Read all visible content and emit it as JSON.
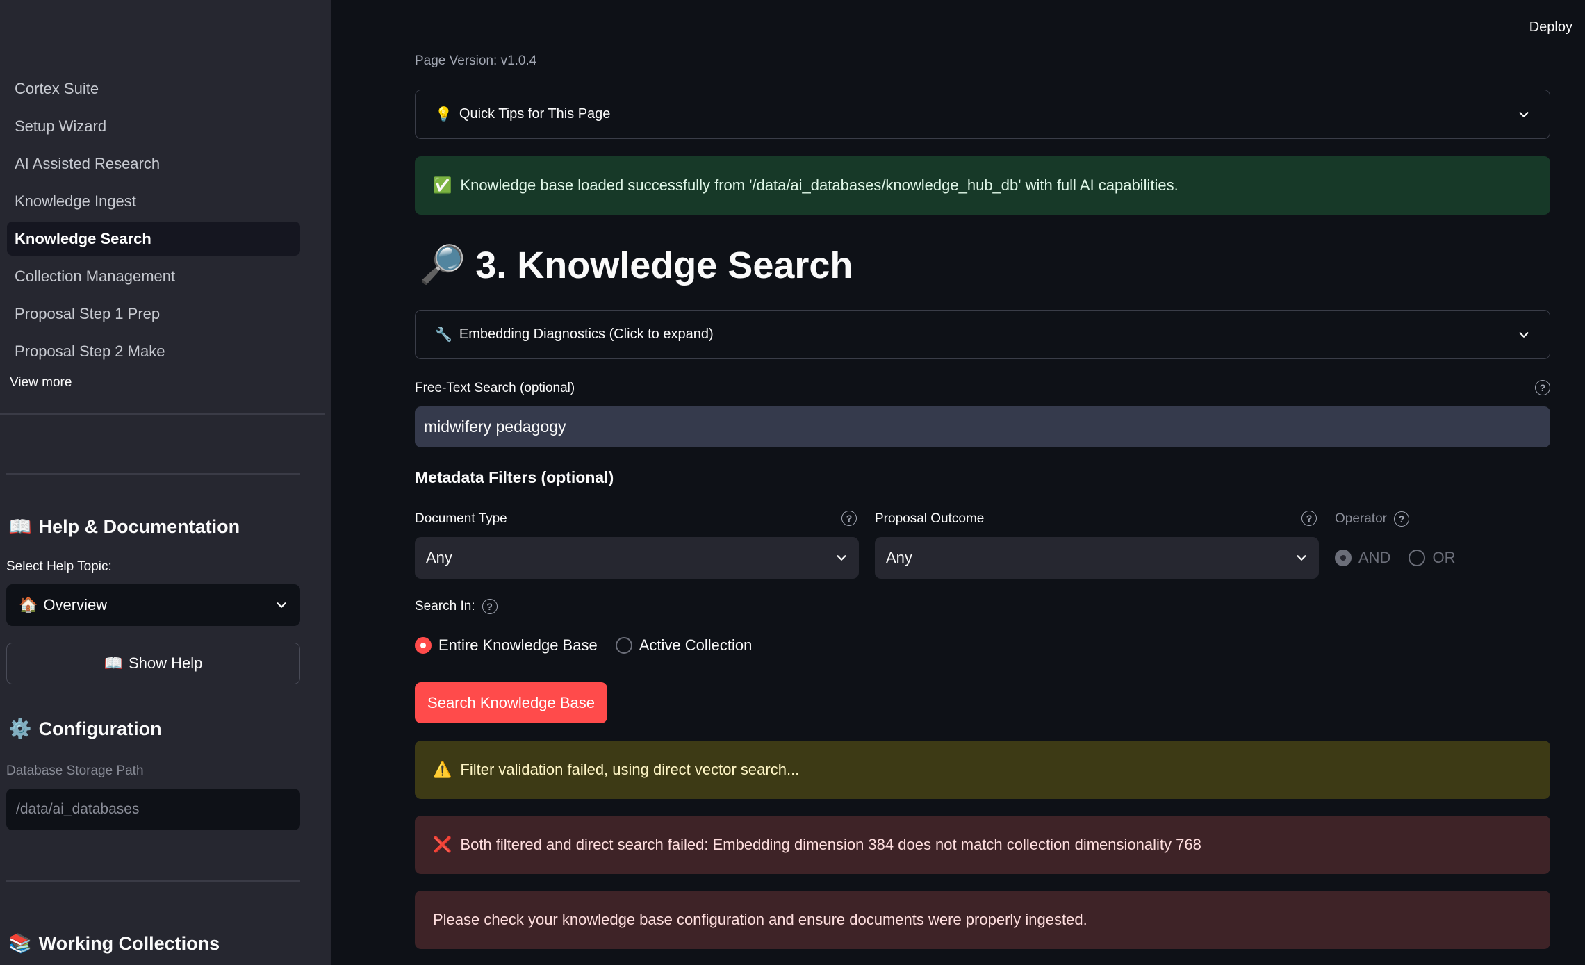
{
  "header": {
    "deploy_label": "Deploy"
  },
  "sidebar": {
    "nav": [
      {
        "label": "Cortex Suite",
        "active": false
      },
      {
        "label": "Setup Wizard",
        "active": false
      },
      {
        "label": "AI Assisted Research",
        "active": false
      },
      {
        "label": "Knowledge Ingest",
        "active": false
      },
      {
        "label": "Knowledge Search",
        "active": true
      },
      {
        "label": "Collection Management",
        "active": false
      },
      {
        "label": "Proposal Step 1 Prep",
        "active": false
      },
      {
        "label": "Proposal Step 2 Make",
        "active": false
      }
    ],
    "view_more": "View more",
    "help": {
      "icon": "📖",
      "heading": "Help & Documentation",
      "select_label": "Select Help Topic:",
      "select_icon": "🏠",
      "select_value": "Overview",
      "button_icon": "📖",
      "button_label": "Show Help"
    },
    "config": {
      "icon": "⚙️",
      "heading": "Configuration",
      "storage_label": "Database Storage Path",
      "storage_value": "/data/ai_databases"
    },
    "collections": {
      "icon": "📚",
      "heading": "Working Collections"
    }
  },
  "main": {
    "page_version": "Page Version: v1.0.4",
    "tips": {
      "icon": "💡",
      "label": "Quick Tips for This Page"
    },
    "success": {
      "icon": "✅",
      "text": "Knowledge base loaded successfully from '/data/ai_databases/knowledge_hub_db' with full AI capabilities."
    },
    "title": {
      "icon": "🔎",
      "text": "3. Knowledge Search"
    },
    "diagnostics": {
      "icon": "🔧",
      "label": "Embedding Diagnostics (Click to expand)"
    },
    "search": {
      "label": "Free-Text Search (optional)",
      "value": "midwifery pedagogy"
    },
    "filters": {
      "heading": "Metadata Filters (optional)",
      "doc_type_label": "Document Type",
      "doc_type_value": "Any",
      "outcome_label": "Proposal Outcome",
      "outcome_value": "Any",
      "operator_label": "Operator",
      "operator_options": [
        "AND",
        "OR"
      ]
    },
    "search_in": {
      "label": "Search In:",
      "options": [
        "Entire Knowledge Base",
        "Active Collection"
      ]
    },
    "search_button": "Search Knowledge Base",
    "warning": {
      "icon": "⚠️",
      "text": "Filter validation failed, using direct vector search..."
    },
    "error": {
      "icon": "❌",
      "text": "Both filtered and direct search failed: Embedding dimension 384 does not match collection dimensionality 768"
    },
    "error2": {
      "text": "Please check your knowledge base configuration and ensure documents were properly ingested."
    }
  },
  "colors": {
    "accent": "#ff4b4b",
    "background": "#0e1117",
    "sidebar": "#262730",
    "success_bg": "#173928",
    "warning_bg": "#3d3a15",
    "error_bg": "#3e2327"
  }
}
